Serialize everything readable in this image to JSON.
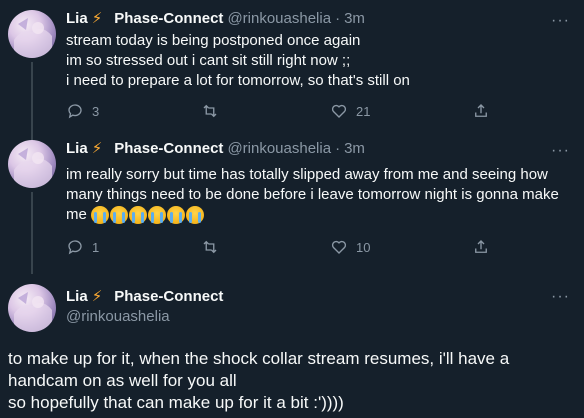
{
  "tweets": [
    {
      "display_name": "Lia",
      "project": "Phase-Connect",
      "handle": "@rinkouashelia",
      "time": "3m",
      "more": "···",
      "lines": [
        "stream today is being postponed once again",
        "im so stressed out i cant sit still right now ;;",
        "i need to prepare a lot for tomorrow, so that's still on"
      ],
      "replies": "3",
      "retweets": "",
      "likes": "21"
    },
    {
      "display_name": "Lia",
      "project": "Phase-Connect",
      "handle": "@rinkouashelia",
      "time": "3m",
      "more": "···",
      "lines": [
        "im really sorry but time has totally slipped away from me and seeing how",
        "many things need to be done before i leave tomorrow night is gonna make",
        "me"
      ],
      "emoji_count": 6,
      "emoji_name": "loudly-crying-face",
      "replies": "1",
      "retweets": "",
      "likes": "10"
    },
    {
      "display_name": "Lia",
      "project": "Phase-Connect",
      "handle": "@rinkouashelia",
      "more": "···",
      "lines": [
        "to make up for it, when the shock collar stream resumes, i'll have a",
        "handcam on as well for you all",
        "so hopefully that can make up for it a bit :'))))"
      ]
    }
  ],
  "colors": {
    "background": "#15202b",
    "text": "#f7f9f9",
    "muted": "#8b98a5",
    "divider": "#38444d",
    "bolt": "#ffac33"
  }
}
